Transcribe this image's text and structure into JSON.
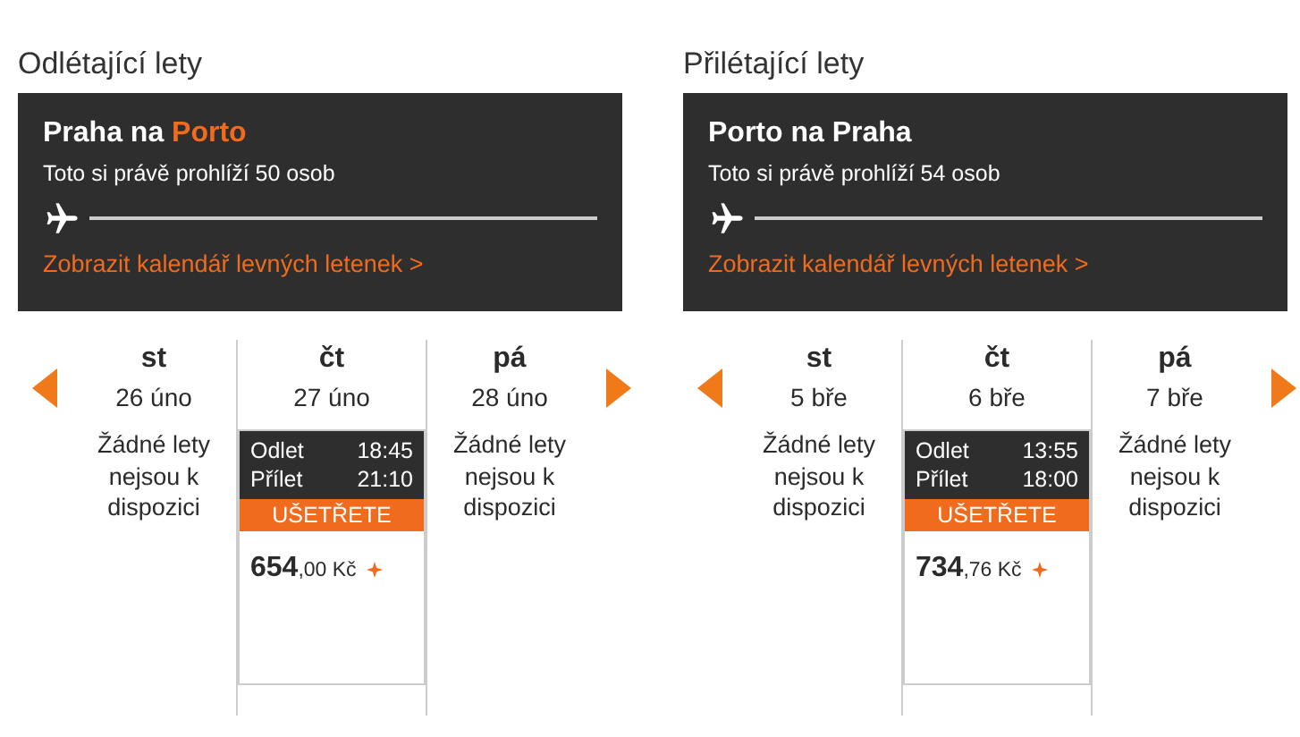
{
  "panels": [
    {
      "heading": "Odlétající lety",
      "route": {
        "title": [
          {
            "text": "Praha na",
            "highlight": false
          },
          {
            "text": "Porto",
            "highlight": true
          }
        ],
        "viewers": "Toto si právě prohlíží 50 osob",
        "calendar_link": "Zobrazit kalendář levných letenek >"
      },
      "days": [
        {
          "weekday": "st",
          "date": "26 úno",
          "selected": false,
          "kind": "empty",
          "message": "Žádné lety nejsou k dispozici"
        },
        {
          "weekday": "čt",
          "date": "27 úno",
          "selected": true,
          "kind": "flight",
          "departure_label": "Odlet",
          "departure_time": "18:45",
          "arrival_label": "Přílet",
          "arrival_time": "21:10",
          "badge": "UŠETŘETE",
          "price": "**654**,00 Kč"
        },
        {
          "weekday": "pá",
          "date": "28 úno",
          "selected": false,
          "kind": "empty",
          "message": "Žádné lety nejsou k dispozici"
        }
      ]
    },
    {
      "heading": "Přilétající lety",
      "route": {
        "title": [
          {
            "text": "Porto na Praha",
            "highlight": false
          }
        ],
        "viewers": "Toto si právě prohlíží 54 osob",
        "calendar_link": "Zobrazit kalendář levných letenek >"
      },
      "days": [
        {
          "weekday": "st",
          "date": "5 bře",
          "selected": false,
          "kind": "empty",
          "message": "Žádné lety nejsou k dispozici"
        },
        {
          "weekday": "čt",
          "date": "6 bře",
          "selected": true,
          "kind": "flight",
          "departure_label": "Odlet",
          "departure_time": "13:55",
          "arrival_label": "Přílet",
          "arrival_time": "18:00",
          "badge": "UŠETŘETE",
          "price": "**734**,76 Kč"
        },
        {
          "weekday": "pá",
          "date": "7 bře",
          "selected": false,
          "kind": "empty",
          "message": "Žádné lety nejsou k dispozici"
        }
      ]
    }
  ]
}
